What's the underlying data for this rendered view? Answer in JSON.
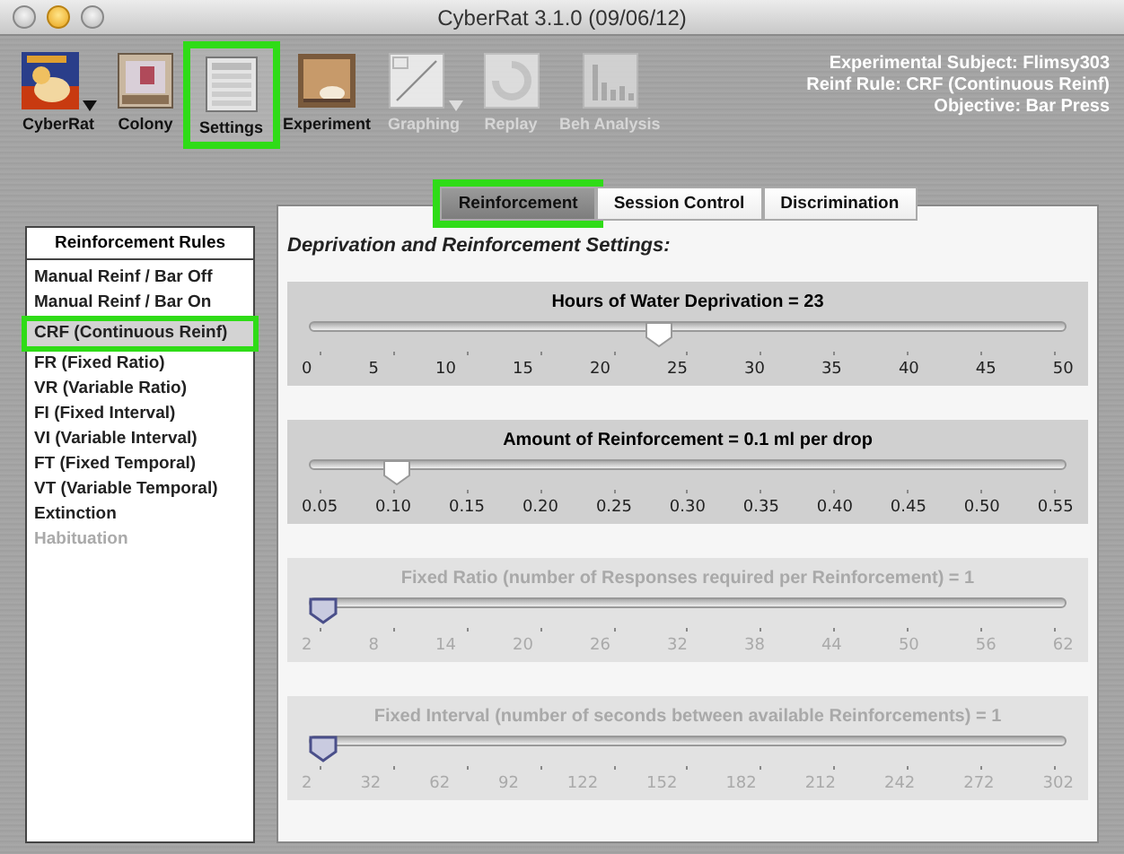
{
  "window": {
    "title": "CyberRat 3.1.0 (09/06/12)"
  },
  "toolbar": [
    {
      "kind": "logo",
      "label": "CyberRat",
      "menu": true,
      "disabled": false,
      "selected": false
    },
    {
      "kind": "colony",
      "label": "Colony",
      "menu": false,
      "disabled": false,
      "selected": false
    },
    {
      "kind": "settings",
      "label": "Settings",
      "menu": false,
      "disabled": false,
      "selected": true
    },
    {
      "kind": "experiment",
      "label": "Experiment",
      "menu": false,
      "disabled": false,
      "selected": false
    },
    {
      "kind": "graphing",
      "label": "Graphing",
      "menu": true,
      "disabled": true,
      "selected": false
    },
    {
      "kind": "replay",
      "label": "Replay",
      "menu": false,
      "disabled": true,
      "selected": false
    },
    {
      "kind": "analysis",
      "label": "Beh Analysis",
      "menu": false,
      "disabled": true,
      "selected": false
    }
  ],
  "subject_info": [
    "Experimental Subject: Flimsy303",
    "Reinf Rule: CRF (Continuous Reinf)",
    "Objective: Bar Press"
  ],
  "tabs": [
    {
      "label": "Reinforcement",
      "selected": true
    },
    {
      "label": "Session Control",
      "selected": false
    },
    {
      "label": "Discrimination",
      "selected": false
    }
  ],
  "rules": {
    "title": "Reinforcement Rules",
    "items": [
      {
        "label": "Manual Reinf / Bar Off",
        "selected": false,
        "disabled": false
      },
      {
        "label": "Manual Reinf / Bar On",
        "selected": false,
        "disabled": false
      },
      {
        "label": "CRF (Continuous Reinf)",
        "selected": true,
        "disabled": false
      },
      {
        "label": "FR (Fixed Ratio)",
        "selected": false,
        "disabled": false
      },
      {
        "label": "VR (Variable Ratio)",
        "selected": false,
        "disabled": false
      },
      {
        "label": "FI (Fixed Interval)",
        "selected": false,
        "disabled": false
      },
      {
        "label": "VI (Variable Interval)",
        "selected": false,
        "disabled": false
      },
      {
        "label": "FT (Fixed Temporal)",
        "selected": false,
        "disabled": false
      },
      {
        "label": "VT (Variable Temporal)",
        "selected": false,
        "disabled": false
      },
      {
        "label": "Extinction",
        "selected": false,
        "disabled": false
      },
      {
        "label": "Habituation",
        "selected": false,
        "disabled": true
      }
    ]
  },
  "heading": "Deprivation and Reinforcement Settings:",
  "sliders": [
    {
      "label": "Hours of Water Deprivation = 23",
      "level": 0.46,
      "disabled": false,
      "ticks": [
        "0",
        "5",
        "10",
        "15",
        "20",
        "25",
        "30",
        "35",
        "40",
        "45",
        "50"
      ]
    },
    {
      "label": "Amount of Reinforcement  = 0.1 ml per drop",
      "level": 0.1,
      "disabled": false,
      "ticks": [
        "0.05",
        "0.10",
        "0.15",
        "0.20",
        "0.25",
        "0.30",
        "0.35",
        "0.40",
        "0.45",
        "0.50",
        "0.55"
      ]
    },
    {
      "label": "Fixed Ratio (number of Responses required per Reinforcement) = 1",
      "level": 0,
      "disabled": true,
      "ticks": [
        "2",
        "8",
        "14",
        "20",
        "26",
        "32",
        "38",
        "44",
        "50",
        "56",
        "62"
      ]
    },
    {
      "label": "Fixed Interval (number of seconds between available Reinforcements) = 1",
      "level": 0,
      "disabled": true,
      "ticks": [
        "2",
        "32",
        "62",
        "92",
        "122",
        "152",
        "182",
        "212",
        "242",
        "272",
        "302"
      ]
    }
  ]
}
